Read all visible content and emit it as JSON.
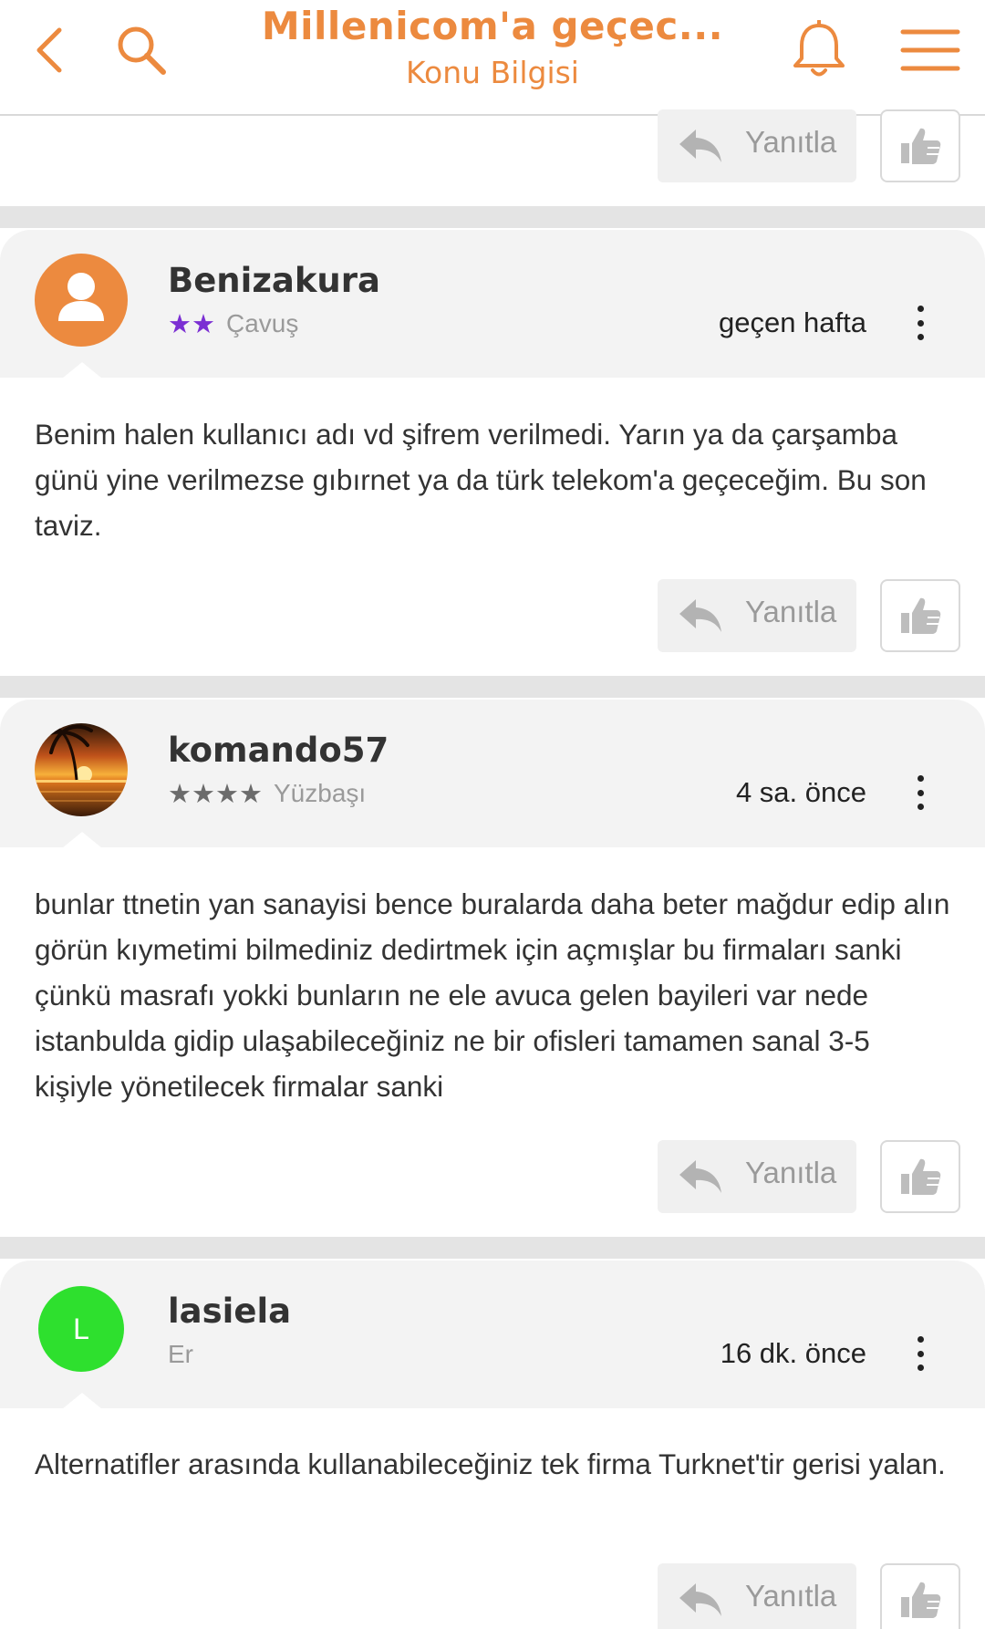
{
  "header": {
    "title": "Millenicom'a geçec...",
    "subtitle": "Konu Bilgisi",
    "icons": [
      "back-arrow-icon",
      "search-icon",
      "bell-icon",
      "hamburger-menu-icon"
    ]
  },
  "actions": {
    "reply_label": "Yanıtla"
  },
  "colors": {
    "accent": "#ec8a3f",
    "star_purple": "#7b2fd3",
    "star_gray": "#6b6b6b",
    "avatar_green": "#2ee02e"
  },
  "posts": [
    {
      "username": "Benizakura",
      "stars": 2,
      "star_color": "purple",
      "rank": "Çavuş",
      "time": "geçen hafta",
      "body": "Benim halen kullanıcı adı vd şifrem verilmedi. Yarın ya da çarşamba günü yine verilmezse gıbırnet ya da türk telekom'a geçeceğim. Bu son taviz."
    },
    {
      "username": "komando57",
      "stars": 4,
      "star_color": "gray",
      "rank": "Yüzbaşı",
      "time": "4 sa. önce",
      "body": "bunlar ttnetin yan sanayisi bence buralarda daha beter mağdur edip alın görün kıymetimi bilmediniz dedirtmek için açmışlar bu firmaları sanki çünkü masrafı yokki bunların ne ele avuca gelen bayileri var nede istanbulda gidip ulaşabileceğiniz ne bir ofisleri tamamen sanal 3-5 kişiyle yönetilecek firmalar sanki"
    },
    {
      "username": "lasiela",
      "avatar_letter": "L",
      "stars": 0,
      "rank": "Er",
      "time": "16 dk. önce",
      "body": "Alternatifler arasında kullanabileceğiniz tek firma Turknet'tir gerisi yalan."
    }
  ]
}
